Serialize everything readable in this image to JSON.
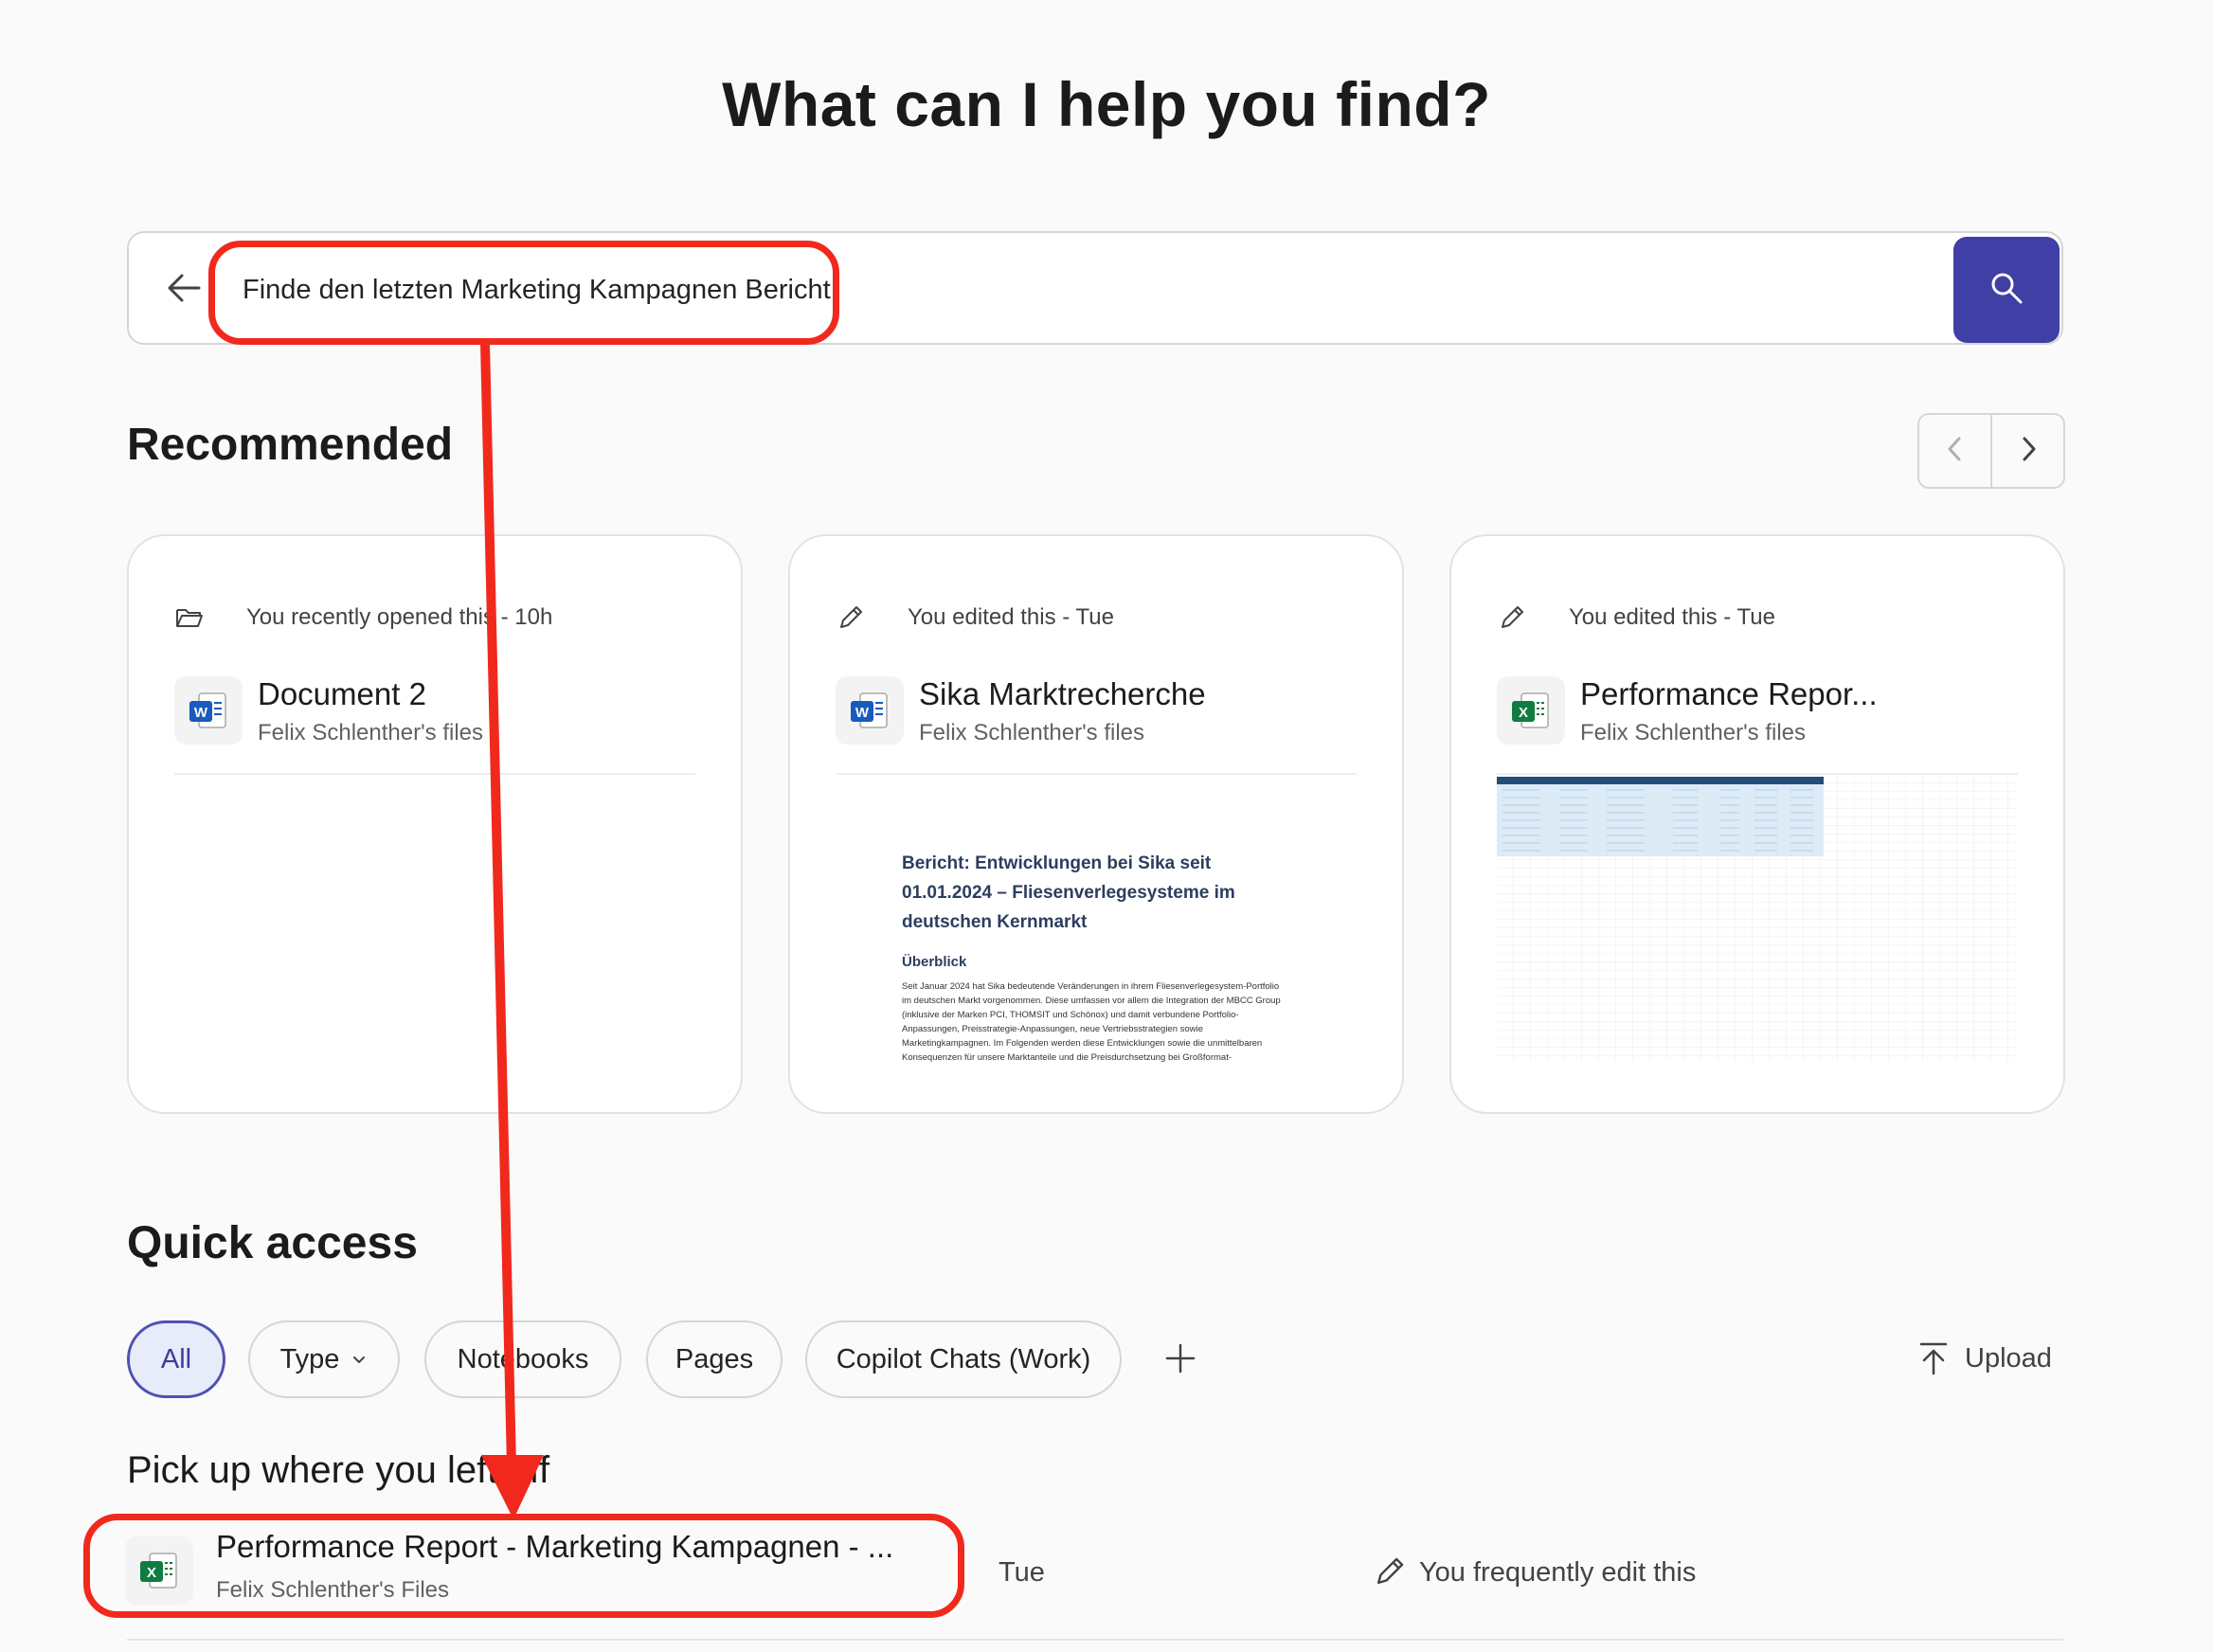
{
  "hero": {
    "title": "What can I help you find?"
  },
  "search": {
    "query": "Finde den letzten Marketing Kampagnen Bericht"
  },
  "recommended": {
    "title": "Recommended",
    "cards": [
      {
        "meta": "You recently opened this - 10h",
        "meta_icon": "folder-open-icon",
        "file_type": "word",
        "file_letter": "W",
        "name": "Document 2",
        "owner": "Felix Schlenther's files"
      },
      {
        "meta": "You edited this - Tue",
        "meta_icon": "pencil-icon",
        "file_type": "word",
        "file_letter": "W",
        "name": "Sika Marktrecherche",
        "owner": "Felix Schlenther's files",
        "preview": {
          "heading": "Bericht: Entwicklungen bei Sika seit 01.01.2024 – Fliesenverlegesysteme im deutschen Kernmarkt",
          "subheading": "Überblick",
          "body": "Seit Januar 2024 hat Sika bedeutende Veränderungen in ihrem Fliesenverlegesystem-Portfolio im deutschen Markt vorgenommen. Diese umfassen vor allem die Integration der MBCC Group (inklusive der Marken PCI, THOMSIT und Schönox) und damit verbundene Portfolio-Anpassungen, Preisstrategie-Anpassungen, neue Vertriebsstrategien sowie Marketingkampagnen. Im Folgenden werden diese Entwicklungen sowie die unmittelbaren Konsequenzen für unsere Marktanteile und die Preisdurchsetzung bei Großformat-Fliesenklebstoffen und Schnellestrich-"
        }
      },
      {
        "meta": "You edited this - Tue",
        "meta_icon": "pencil-icon",
        "file_type": "excel",
        "file_letter": "X",
        "name": "Performance Repor...",
        "owner": "Felix Schlenther's files"
      }
    ]
  },
  "quick_access": {
    "title": "Quick access",
    "filters": [
      {
        "label": "All",
        "active": true
      },
      {
        "label": "Type",
        "dropdown": true
      },
      {
        "label": "Notebooks"
      },
      {
        "label": "Pages"
      },
      {
        "label": "Copilot Chats (Work)"
      }
    ],
    "upload_label": "Upload"
  },
  "pickup": {
    "title": "Pick up where you left off",
    "rows": [
      {
        "file_type": "excel",
        "file_letter": "X",
        "name": "Performance Report - Marketing Kampagnen - ...",
        "owner": "Felix Schlenther's Files",
        "date": "Tue",
        "activity": "You frequently edit this"
      }
    ]
  },
  "colors": {
    "accent": "#3f3fa6",
    "annotation": "#f1291d",
    "word": "#185abd",
    "excel": "#107c41"
  }
}
